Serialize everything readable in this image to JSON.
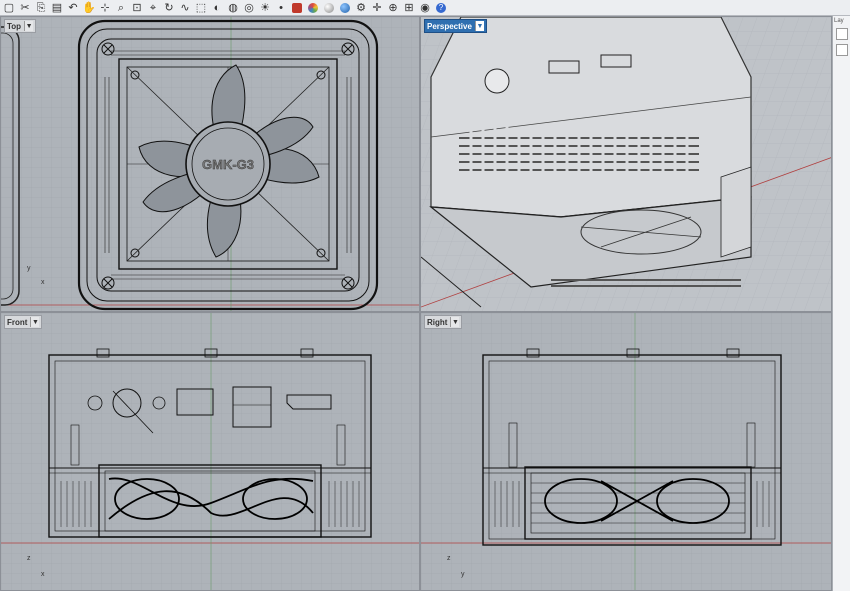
{
  "toolbar": {
    "icons": [
      "new-icon",
      "cut-icon",
      "copy-icon",
      "paste-icon",
      "undo-icon",
      "pan-icon",
      "select-icon",
      "zoom-icon",
      "zoom-extents-icon",
      "zoom-window-icon",
      "rotate-icon",
      "curve-icon",
      "wireframe-icon",
      "shaded-icon",
      "render-icon",
      "camera-icon",
      "light-icon",
      "point-icon",
      "layer-icon",
      "color-icon",
      "sphere-icon",
      "globe-icon",
      "settings-icon",
      "gumball-icon",
      "snap-icon",
      "grid-icon",
      "osnap-icon",
      "help-icon"
    ],
    "colors": {
      "color_wheel": "#e04a3a",
      "globe": "#2a72c4",
      "help": "#3569d0"
    }
  },
  "viewports": {
    "top": {
      "label": "Top",
      "axis_y": "y",
      "axis_x": "x"
    },
    "perspective": {
      "label": "Perspective"
    },
    "front": {
      "label": "Front",
      "axis_y": "z",
      "axis_x": "x"
    },
    "right": {
      "label": "Right",
      "axis_y": "z",
      "axis_x": "y"
    }
  },
  "model": {
    "fan_label": "GMK-G3"
  },
  "side_panel": {
    "label": "Lay"
  }
}
